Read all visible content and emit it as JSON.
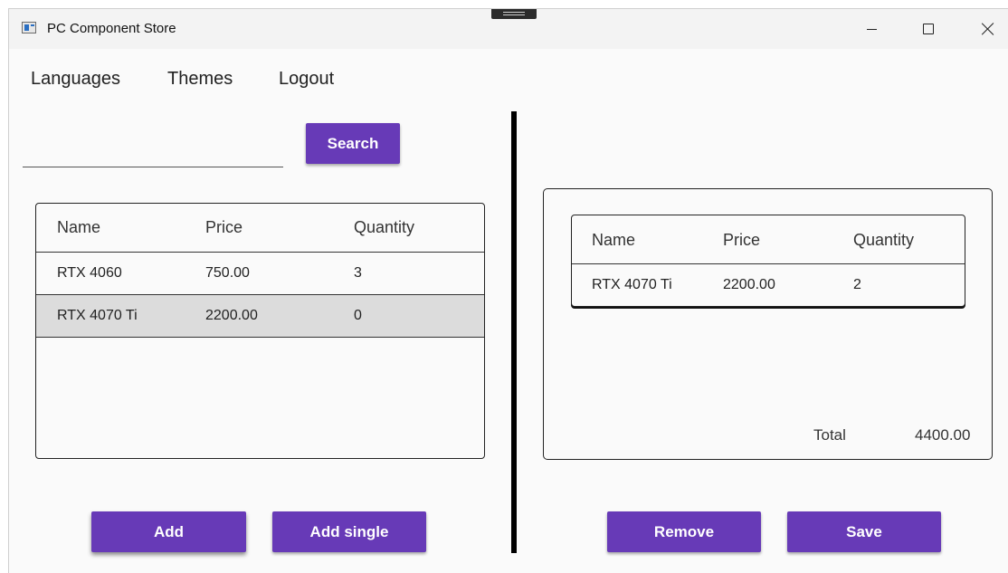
{
  "window": {
    "title": "PC Component Store"
  },
  "menu": {
    "items": [
      "Languages",
      "Themes",
      "Logout"
    ]
  },
  "search": {
    "value": "",
    "button_label": "Search"
  },
  "products": {
    "columns": [
      "Name",
      "Price",
      "Quantity"
    ],
    "rows": [
      {
        "name": "RTX 4060",
        "price": "750.00",
        "quantity": "3"
      },
      {
        "name": "RTX 4070 Ti",
        "price": "2200.00",
        "quantity": "0"
      }
    ],
    "selected_row": 1
  },
  "cart": {
    "columns": [
      "Name",
      "Price",
      "Quantity"
    ],
    "rows": [
      {
        "name": "RTX 4070 Ti",
        "price": "2200.00",
        "quantity": "2"
      }
    ],
    "total_label": "Total",
    "total_value": "4400.00"
  },
  "actions": {
    "add": "Add",
    "add_single": "Add single",
    "remove": "Remove",
    "save": "Save"
  },
  "colors": {
    "accent": "#673ab7",
    "selected_row": "#dcdcdc"
  }
}
